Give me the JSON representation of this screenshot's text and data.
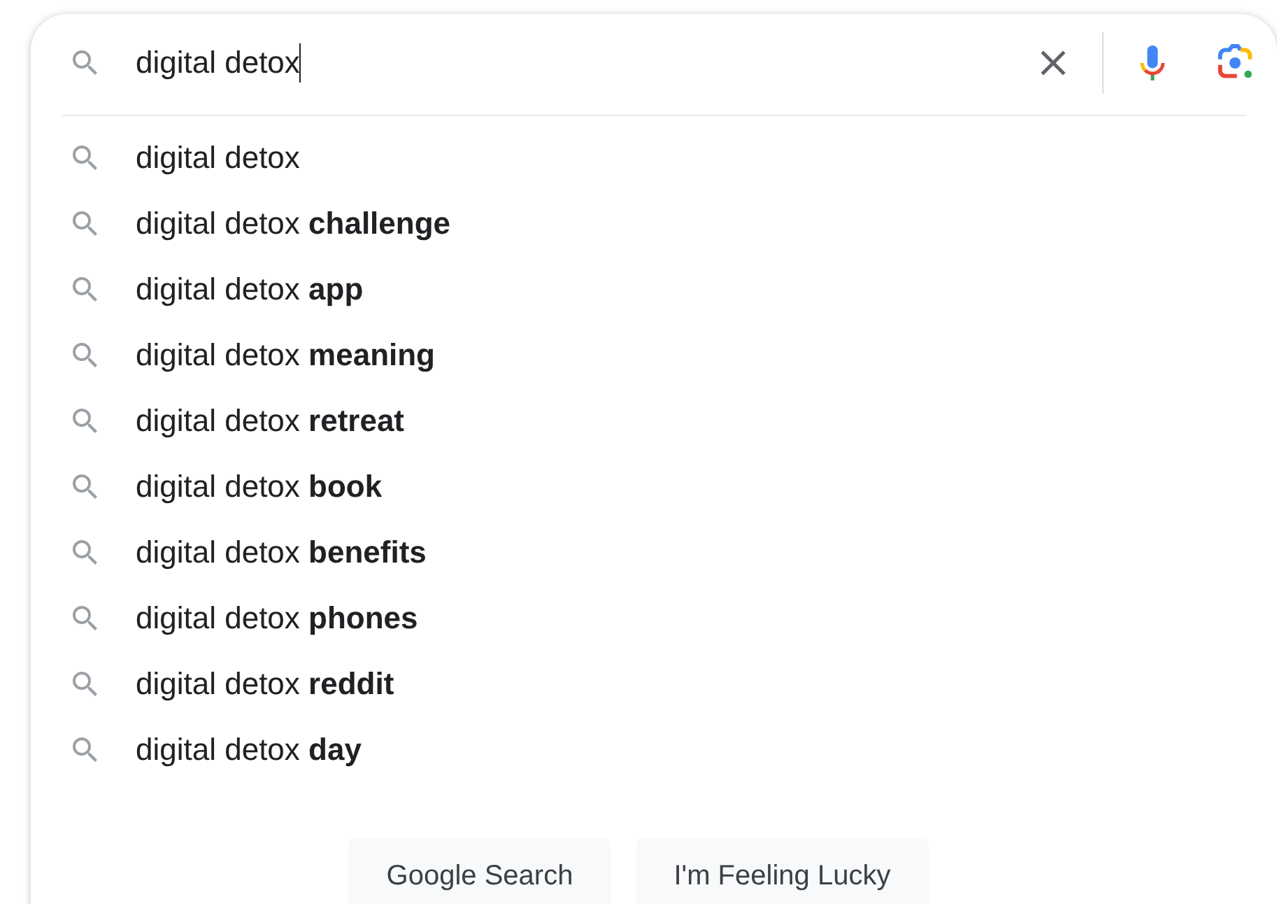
{
  "search": {
    "value": "digital detox"
  },
  "suggestions": [
    "digital detox",
    "digital detox **challenge**",
    "digital detox **app**",
    "digital detox **meaning**",
    "digital detox **retreat**",
    "digital detox **book**",
    "digital detox **benefits**",
    "digital detox **phones**",
    "digital detox **reddit**",
    "digital detox **day**"
  ],
  "buttons": [
    "Google Search",
    "I'm Feeling Lucky"
  ]
}
